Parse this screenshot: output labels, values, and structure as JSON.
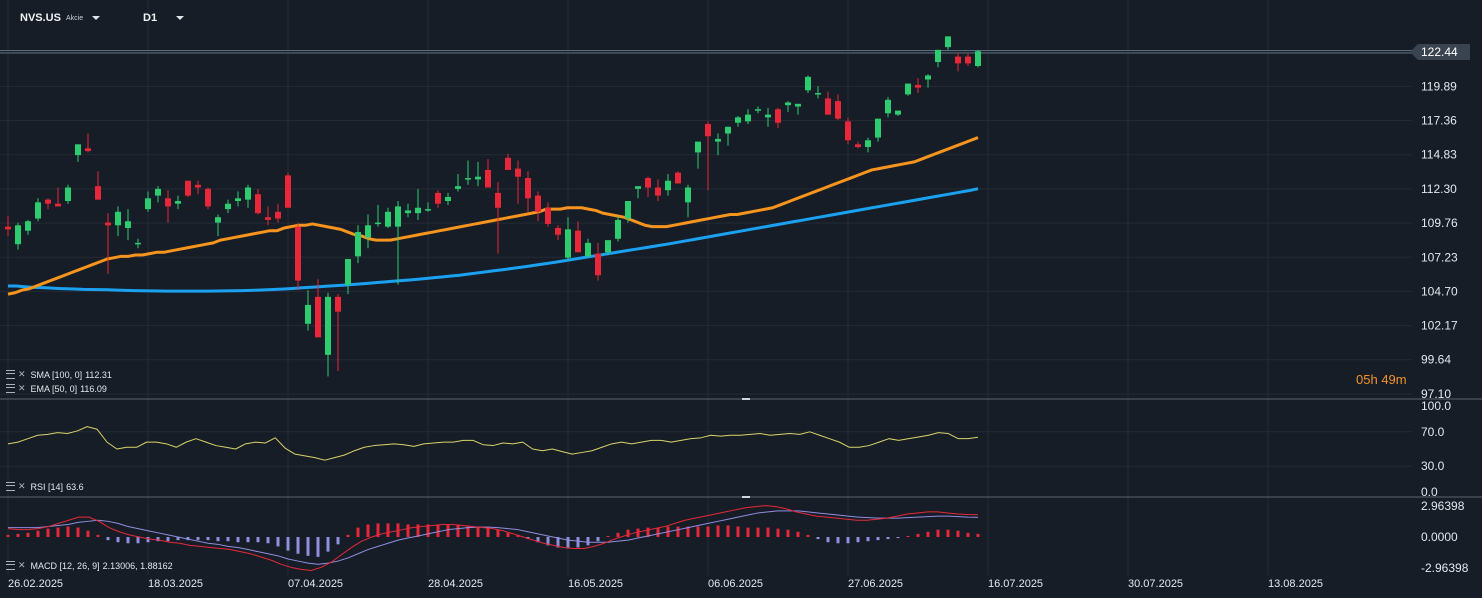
{
  "toolbar": {
    "symbol": "NVS.US",
    "symbol_sub": "Akcie",
    "interval": "D1"
  },
  "countdown": {
    "hours": "05",
    "h": "h",
    "minutes": "49",
    "m": "m"
  },
  "legends": {
    "sma": {
      "label": "SMA [100,  0]",
      "value": "112.31"
    },
    "ema": {
      "label": "EMA [50,  0]",
      "value": "116.09"
    },
    "rsi": {
      "label": "RSI [14]",
      "value": "63.6"
    },
    "macd": {
      "label": "MACD [12,  26,  9]",
      "value": "2.13006,  1.88162"
    }
  },
  "colors": {
    "up": "#2ecc71",
    "down": "#e8283a",
    "ema": "#f7941d",
    "sma": "#1ba1f2",
    "rsi": "#d9d36a",
    "macd_line": "#e8283a",
    "macd_signal": "#8f8fe0"
  },
  "chart_data": [
    {
      "type": "candlestick",
      "price_ticks": [
        "122.44",
        "119.89",
        "117.36",
        "114.83",
        "112.30",
        "109.76",
        "107.23",
        "104.70",
        "102.17",
        "99.64",
        "97.10"
      ],
      "last_price": "122.44",
      "ylim": [
        97.1,
        122.44
      ],
      "date_labels": [
        "26.02.2025",
        "18.03.2025",
        "07.04.2025",
        "28.04.2025",
        "16.05.2025",
        "06.06.2025",
        "27.06.2025",
        "16.07.2025",
        "30.07.2025",
        "13.08.2025"
      ],
      "candles": [
        [
          109.5,
          110.3,
          108.8,
          109.3
        ],
        [
          108.2,
          109.8,
          107.8,
          109.6
        ],
        [
          109.2,
          110.0,
          108.9,
          109.9
        ],
        [
          110.1,
          111.6,
          109.9,
          111.3
        ],
        [
          111.5,
          111.6,
          110.8,
          111.2
        ],
        [
          111.2,
          112.4,
          111.0,
          111.0
        ],
        [
          111.4,
          112.6,
          111.2,
          112.4
        ],
        [
          114.8,
          115.6,
          114.3,
          115.6
        ],
        [
          115.3,
          116.4,
          115.0,
          115.1
        ],
        [
          112.5,
          113.6,
          111.5,
          111.5
        ],
        [
          109.8,
          110.5,
          106.0,
          109.6
        ],
        [
          109.6,
          111.0,
          108.8,
          110.6
        ],
        [
          109.4,
          110.8,
          108.5,
          109.9
        ],
        [
          108.3,
          108.6,
          107.9,
          108.3
        ],
        [
          110.8,
          112.1,
          110.6,
          111.6
        ],
        [
          111.8,
          112.5,
          111.3,
          112.3
        ],
        [
          111.6,
          112.2,
          109.8,
          111.0
        ],
        [
          111.2,
          111.8,
          110.8,
          111.4
        ],
        [
          112.9,
          112.9,
          111.7,
          111.8
        ],
        [
          112.6,
          112.9,
          111.9,
          112.4
        ],
        [
          112.3,
          112.4,
          110.8,
          111.0
        ],
        [
          109.8,
          110.4,
          108.8,
          110.2
        ],
        [
          110.8,
          111.5,
          110.5,
          111.2
        ],
        [
          111.4,
          112.1,
          111.0,
          111.6
        ],
        [
          111.5,
          112.6,
          110.9,
          112.4
        ],
        [
          111.9,
          112.3,
          110.4,
          110.5
        ],
        [
          110.2,
          111.0,
          109.6,
          110.0
        ],
        [
          110.6,
          111.2,
          109.8,
          110.1
        ],
        [
          113.3,
          113.5,
          111.0,
          110.9
        ],
        [
          109.5,
          109.8,
          104.8,
          105.5
        ],
        [
          102.3,
          104.8,
          101.8,
          103.7
        ],
        [
          104.3,
          105.6,
          102.0,
          101.3
        ],
        [
          100.0,
          104.6,
          98.4,
          104.3
        ],
        [
          104.3,
          104.5,
          98.8,
          103.2
        ],
        [
          105.2,
          106.9,
          104.5,
          107.1
        ],
        [
          107.3,
          109.6,
          106.8,
          109.1
        ],
        [
          108.7,
          110.4,
          107.9,
          109.6
        ],
        [
          109.8,
          111.1,
          109.5,
          109.8
        ],
        [
          109.5,
          110.9,
          109.4,
          110.6
        ],
        [
          109.5,
          111.4,
          105.2,
          111.0
        ],
        [
          110.5,
          111.2,
          110.2,
          110.7
        ],
        [
          110.5,
          112.3,
          110.0,
          110.9
        ],
        [
          110.8,
          111.3,
          110.6,
          110.8
        ],
        [
          112.0,
          112.2,
          110.9,
          111.2
        ],
        [
          111.4,
          112.0,
          111.1,
          111.7
        ],
        [
          112.3,
          113.4,
          112.1,
          112.5
        ],
        [
          113.0,
          114.4,
          112.6,
          113.1
        ],
        [
          113.0,
          114.3,
          112.5,
          113.2
        ],
        [
          113.7,
          114.5,
          113.0,
          112.4
        ],
        [
          112.0,
          112.8,
          107.5,
          110.9
        ],
        [
          114.6,
          114.9,
          114.2,
          113.7
        ],
        [
          113.8,
          114.4,
          111.2,
          113.2
        ],
        [
          113.1,
          113.6,
          110.6,
          111.6
        ],
        [
          111.8,
          112.1,
          109.9,
          110.6
        ],
        [
          110.9,
          111.3,
          109.5,
          109.7
        ],
        [
          109.4,
          109.6,
          108.5,
          108.9
        ],
        [
          107.2,
          110.2,
          107.0,
          109.3
        ],
        [
          109.2,
          109.9,
          108.2,
          107.6
        ],
        [
          107.3,
          108.6,
          107.2,
          108.3
        ],
        [
          107.5,
          108.3,
          105.5,
          105.9
        ],
        [
          107.6,
          108.0,
          107.4,
          108.5
        ],
        [
          108.6,
          110.3,
          108.4,
          110.0
        ],
        [
          110.1,
          111.0,
          109.8,
          111.4
        ],
        [
          112.3,
          112.4,
          111.6,
          112.5
        ],
        [
          113.1,
          113.2,
          111.7,
          112.4
        ],
        [
          112.4,
          113.0,
          111.4,
          111.8
        ],
        [
          112.2,
          113.4,
          111.8,
          112.9
        ],
        [
          113.5,
          113.6,
          112.7,
          112.7
        ],
        [
          111.3,
          112.6,
          110.2,
          112.4
        ],
        [
          115.0,
          115.5,
          113.8,
          115.8
        ],
        [
          117.1,
          117.3,
          112.2,
          116.2
        ],
        [
          115.8,
          116.4,
          114.8,
          116.0
        ],
        [
          116.4,
          116.9,
          115.5,
          116.9
        ],
        [
          117.2,
          117.7,
          116.9,
          117.6
        ],
        [
          117.3,
          118.2,
          117.1,
          117.8
        ],
        [
          118.1,
          118.4,
          117.9,
          118.2
        ],
        [
          117.6,
          118.3,
          116.9,
          117.8
        ],
        [
          118.2,
          118.3,
          116.8,
          117.2
        ],
        [
          118.5,
          118.8,
          118.0,
          118.7
        ],
        [
          118.4,
          118.6,
          117.8,
          118.6
        ],
        [
          119.6,
          120.7,
          119.4,
          120.6
        ],
        [
          119.3,
          119.9,
          119.0,
          119.4
        ],
        [
          119.0,
          119.5,
          117.8,
          117.8
        ],
        [
          118.8,
          119.3,
          117.4,
          117.5
        ],
        [
          117.3,
          117.6,
          115.6,
          115.9
        ],
        [
          115.6,
          115.8,
          115.3,
          115.4
        ],
        [
          115.4,
          116.1,
          115.0,
          115.9
        ],
        [
          116.1,
          117.5,
          115.8,
          117.5
        ],
        [
          117.9,
          119.1,
          117.6,
          118.9
        ],
        [
          117.8,
          118.0,
          117.7,
          118.1
        ],
        [
          119.3,
          120.1,
          119.2,
          120.1
        ],
        [
          120.0,
          120.5,
          119.4,
          119.8
        ],
        [
          120.4,
          120.8,
          119.8,
          120.7
        ],
        [
          121.7,
          122.6,
          121.3,
          122.6
        ],
        [
          122.8,
          123.5,
          122.6,
          123.6
        ],
        [
          122.1,
          122.4,
          121.0,
          121.6
        ],
        [
          122.1,
          122.3,
          121.4,
          121.6
        ],
        [
          121.4,
          122.6,
          121.3,
          122.5
        ]
      ]
    },
    {
      "type": "line",
      "name": "EMA [50, 0]",
      "values": [
        104.5,
        104.6,
        104.8,
        104.9,
        105.1,
        105.3,
        105.5,
        105.7,
        105.9,
        106.1,
        106.3,
        106.5,
        106.7,
        106.9,
        107.1,
        107.2,
        107.3,
        107.3,
        107.4,
        107.4,
        107.5,
        107.6,
        107.6,
        107.7,
        107.8,
        107.9,
        108.0,
        108.1,
        108.2,
        108.3,
        108.5,
        108.6,
        108.7,
        108.8,
        108.9,
        109.0,
        109.1,
        109.2,
        109.2,
        109.4,
        109.5,
        109.6,
        109.6,
        109.7,
        109.6,
        109.5,
        109.4,
        109.3,
        109.1,
        108.9,
        108.8,
        108.6,
        108.5,
        108.5,
        108.5,
        108.6,
        108.7,
        108.8,
        108.9,
        109.0,
        109.1,
        109.2,
        109.3,
        109.4,
        109.5,
        109.6,
        109.7,
        109.8,
        109.9,
        110.0,
        110.1,
        110.2,
        110.3,
        110.4,
        110.5,
        110.6,
        110.8,
        110.8,
        110.8,
        110.9,
        110.9,
        110.9,
        110.8,
        110.7,
        110.5,
        110.4,
        110.3,
        110.2,
        110.0,
        109.8,
        109.6,
        109.5,
        109.5,
        109.5,
        109.6,
        109.7,
        109.8,
        109.9,
        110.0,
        110.1,
        110.2,
        110.3,
        110.4,
        110.4,
        110.5,
        110.6,
        110.7,
        110.8,
        110.9,
        111.1,
        111.3,
        111.5,
        111.7,
        111.9,
        112.1,
        112.3,
        112.5,
        112.7,
        112.9,
        113.1,
        113.3,
        113.5,
        113.7,
        113.8,
        113.9,
        114.0,
        114.1,
        114.2,
        114.3,
        114.5,
        114.7,
        114.9,
        115.1,
        115.3,
        115.5,
        115.7,
        115.9,
        116.1
      ]
    },
    {
      "type": "line",
      "name": "SMA [100, 0]",
      "values": [
        105.1,
        105.1,
        105.05,
        105.0,
        104.98,
        104.95,
        104.92,
        104.9,
        104.88,
        104.85,
        104.84,
        104.83,
        104.82,
        104.8,
        104.78,
        104.76,
        104.75,
        104.74,
        104.73,
        104.72,
        104.72,
        104.72,
        104.72,
        104.72,
        104.72,
        104.73,
        104.74,
        104.75,
        104.76,
        104.78,
        104.8,
        104.82,
        104.85,
        104.88,
        104.92,
        104.96,
        105.0,
        105.04,
        105.08,
        105.12,
        105.16,
        105.2,
        105.25,
        105.3,
        105.35,
        105.4,
        105.45,
        105.5,
        105.55,
        105.6,
        105.66,
        105.72,
        105.78,
        105.84,
        105.9,
        105.98,
        106.06,
        106.14,
        106.22,
        106.3,
        106.38,
        106.46,
        106.55,
        106.64,
        106.73,
        106.82,
        106.92,
        107.02,
        107.12,
        107.22,
        107.32,
        107.42,
        107.52,
        107.62,
        107.72,
        107.82,
        107.92,
        108.02,
        108.12,
        108.22,
        108.33,
        108.44,
        108.55,
        108.66,
        108.77,
        108.88,
        108.99,
        109.1,
        109.21,
        109.32,
        109.43,
        109.54,
        109.65,
        109.76,
        109.87,
        109.98,
        110.09,
        110.2,
        110.31,
        110.42,
        110.53,
        110.64,
        110.75,
        110.86,
        110.97,
        111.08,
        111.19,
        111.3,
        111.41,
        111.52,
        111.63,
        111.74,
        111.85,
        111.96,
        112.07,
        112.18,
        112.31
      ]
    },
    {
      "type": "line",
      "name": "RSI [14]",
      "ylim": [
        0,
        100
      ],
      "ticks": [
        "100.0",
        "70.0",
        "30.0",
        "0.0"
      ],
      "values": [
        56,
        58,
        62,
        66,
        67,
        69,
        68,
        71,
        76,
        73,
        58,
        50,
        52,
        52,
        58,
        58,
        56,
        52,
        58,
        62,
        58,
        54,
        52,
        50,
        56,
        58,
        57,
        63,
        51,
        44,
        42,
        40,
        37,
        40,
        43,
        48,
        52,
        54,
        55,
        56,
        55,
        53,
        56,
        57,
        58,
        58,
        60,
        60,
        55,
        54,
        57,
        56,
        58,
        50,
        48,
        50,
        47,
        44,
        46,
        48,
        52,
        56,
        58,
        56,
        58,
        60,
        60,
        58,
        60,
        62,
        63,
        66,
        65,
        66,
        66,
        67,
        68,
        66,
        67,
        68,
        67,
        70,
        66,
        62,
        58,
        52,
        52,
        54,
        58,
        62,
        60,
        62,
        64,
        66,
        69,
        68,
        62,
        62,
        63.6
      ]
    },
    {
      "type": "bar_line",
      "name": "MACD [12, 26, 9]",
      "ticks": [
        "2.96398",
        "0.0000",
        "-2.96398"
      ],
      "ylim": [
        -2.96398,
        2.96398
      ],
      "histogram": [
        0.2,
        0.3,
        0.4,
        0.6,
        0.8,
        0.9,
        1.0,
        0.9,
        0.6,
        0.2,
        -0.3,
        -0.5,
        -0.6,
        -0.6,
        -0.5,
        -0.4,
        -0.4,
        -0.3,
        -0.3,
        -0.3,
        -0.3,
        -0.4,
        -0.4,
        -0.5,
        -0.5,
        -0.5,
        -0.6,
        -0.9,
        -1.3,
        -1.6,
        -1.8,
        -1.9,
        -1.4,
        -0.7,
        0.2,
        0.9,
        1.2,
        1.3,
        1.3,
        1.3,
        1.2,
        1.2,
        1.2,
        1.2,
        1.2,
        1.2,
        1.1,
        1.0,
        0.9,
        0.7,
        0.4,
        0.2,
        -0.2,
        -0.5,
        -0.8,
        -1.0,
        -1.1,
        -1.0,
        -0.8,
        -0.4,
        0.1,
        0.4,
        0.7,
        0.8,
        0.9,
        0.9,
        1.0,
        1.0,
        1.0,
        1.0,
        1.0,
        1.1,
        1.1,
        1.0,
        0.9,
        0.9,
        0.9,
        0.8,
        0.7,
        0.5,
        0.2,
        -0.2,
        -0.5,
        -0.6,
        -0.6,
        -0.5,
        -0.4,
        -0.3,
        -0.2,
        -0.1,
        0.1,
        0.3,
        0.5,
        0.7,
        0.7,
        0.6,
        0.4,
        0.3
      ],
      "macd": [
        0.8,
        0.7,
        0.7,
        0.8,
        1.0,
        1.3,
        1.6,
        1.9,
        1.9,
        1.5,
        0.9,
        0.5,
        0.2,
        0.0,
        -0.2,
        -0.3,
        -0.5,
        -0.6,
        -0.8,
        -0.9,
        -1.0,
        -1.1,
        -1.2,
        -1.4,
        -1.6,
        -1.9,
        -2.2,
        -2.6,
        -2.9,
        -3.1,
        -3.2,
        -2.9,
        -2.4,
        -1.7,
        -1.0,
        -0.4,
        0.0,
        0.3,
        0.5,
        0.7,
        0.9,
        1.0,
        1.1,
        1.2,
        1.2,
        1.1,
        1.0,
        0.9,
        0.8,
        0.6,
        0.3,
        0.0,
        -0.3,
        -0.6,
        -0.8,
        -1.0,
        -1.1,
        -1.1,
        -0.9,
        -0.6,
        -0.2,
        0.1,
        0.4,
        0.6,
        0.8,
        1.0,
        1.3,
        1.6,
        1.8,
        2.0,
        2.2,
        2.4,
        2.6,
        2.8,
        2.9,
        3.0,
        2.9,
        2.7,
        2.4,
        2.2,
        2.0,
        1.9,
        1.8,
        1.7,
        1.6,
        1.6,
        1.7,
        1.8,
        2.0,
        2.2,
        2.3,
        2.4,
        2.4,
        2.3,
        2.2,
        2.15,
        2.13
      ],
      "signal": [
        0.9,
        0.9,
        0.9,
        0.9,
        1.0,
        1.1,
        1.2,
        1.4,
        1.5,
        1.6,
        1.5,
        1.3,
        1.0,
        0.8,
        0.6,
        0.4,
        0.2,
        0.0,
        -0.2,
        -0.4,
        -0.6,
        -0.7,
        -0.9,
        -1.0,
        -1.2,
        -1.4,
        -1.6,
        -1.8,
        -2.1,
        -2.3,
        -2.5,
        -2.6,
        -2.5,
        -2.3,
        -2.0,
        -1.6,
        -1.2,
        -0.9,
        -0.6,
        -0.3,
        -0.1,
        0.1,
        0.3,
        0.5,
        0.7,
        0.8,
        0.9,
        0.95,
        0.95,
        0.9,
        0.8,
        0.7,
        0.5,
        0.3,
        0.1,
        -0.1,
        -0.3,
        -0.4,
        -0.5,
        -0.5,
        -0.5,
        -0.4,
        -0.3,
        -0.1,
        0.1,
        0.3,
        0.5,
        0.7,
        0.9,
        1.1,
        1.3,
        1.5,
        1.7,
        1.9,
        2.1,
        2.3,
        2.4,
        2.5,
        2.5,
        2.5,
        2.4,
        2.3,
        2.2,
        2.1,
        2.0,
        1.9,
        1.85,
        1.8,
        1.8,
        1.8,
        1.85,
        1.9,
        1.95,
        2.0,
        2.0,
        1.95,
        1.9,
        1.88
      ]
    }
  ]
}
